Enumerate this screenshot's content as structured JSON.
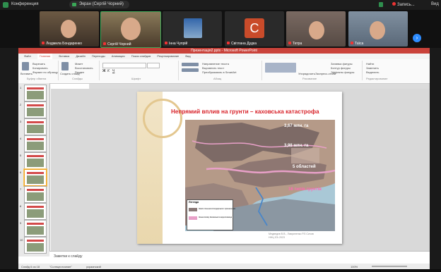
{
  "zoom_window": {
    "title": "Конференция",
    "sharing_label": "Экран (Сергій Чорний)",
    "recording_label": "Запись...",
    "view_label": "Вид",
    "colors": {
      "share_indicator": "#3aa757",
      "rec_dot": "#e33333",
      "next_button": "#2d8cff"
    }
  },
  "participants": [
    {
      "name": "Людмила Бондаренко"
    },
    {
      "name": "Сергій Чорний"
    },
    {
      "name": "Інна Чупрій"
    },
    {
      "name": "Світлана Дудка",
      "avatar_letter": "С",
      "avatar_color": "#c94b2a"
    },
    {
      "name": "Тетра"
    },
    {
      "name": "Таїса"
    }
  ],
  "next_button_icon": "chevron-right-icon",
  "powerpoint": {
    "window_title": "Презентація2.pptx - Microsoft PowerPoint",
    "tabs": [
      "Файл",
      "Главная",
      "Вставка",
      "Дизайн",
      "Переходы",
      "Анимация",
      "Показ слайдов",
      "Рецензирование",
      "Вид"
    ],
    "active_tab": "Главная",
    "ribbon": {
      "paste": "Вставить",
      "cut": "Вырезать",
      "copy": "Копировать",
      "format_painter": "Формат по образцу",
      "clipboard_group": "Буфер обмена",
      "create_slide": "Создать слайд",
      "layout": "Макет",
      "reset": "Восстановить",
      "section": "Раздел",
      "slides_group": "Слайды",
      "font_group": "Шрифт",
      "paragraph_group": "Абзац",
      "text_direction": "Направление текста",
      "align_text": "Выровнять текст",
      "convert_smartart": "Преобразовать в SmartArt",
      "drawing_group": "Рисование",
      "arrange": "Упорядочить",
      "quick_styles": "Экспресс-стили",
      "shape_fill": "Заливка фигуры",
      "shape_outline": "Контур фигуры",
      "shape_effects": "Эффекты фигуры",
      "find": "Найти",
      "replace": "Заменить",
      "select": "Выделить",
      "editing_group": "Редактирование"
    },
    "slide": {
      "title": "Непрямий вплив на грунти – каховська катастрофа",
      "map_labels": [
        {
          "text": "3,67 млн. га",
          "color": "#ffffff"
        },
        {
          "text": "3,98 млн. га",
          "color": "#ffffff"
        },
        {
          "text": "5 областей",
          "color": "#ffffff"
        },
        {
          "text": "16 типів грунтів",
          "color": "#ff69b4"
        }
      ],
      "legend_title": "Легенда",
      "legend_items": [
        {
          "label": "Землі сільськогосподарського призначення",
          "color": "#8a7a78"
        },
        {
          "label": "Зона впливу Каховського водосховища",
          "color": "#e8a0c8"
        }
      ],
      "source_line1": "Медведєв В.В., Лавриненко Р.Л.Сичов",
      "source_line2": "ННЦ ІГА 2023"
    },
    "slide_numbers": [
      "1",
      "2",
      "3",
      "4",
      "5",
      "6",
      "7",
      "8",
      "9",
      "10"
    ],
    "selected_slide": "6",
    "notes_placeholder": "Заметки к слайду",
    "status_slide": "Слайд 6 из 18",
    "status_theme": "\"Солнцестояние\"",
    "status_lang": "украинский",
    "zoom_percent": "100%"
  }
}
